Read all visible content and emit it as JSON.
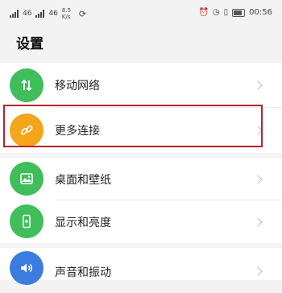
{
  "status_bar": {
    "carrier_1": "46",
    "carrier_2": "46",
    "speed": "8.5 K/s",
    "time": "00:56"
  },
  "page": {
    "title": "设置"
  },
  "settings": {
    "items": [
      {
        "label": "移动网络",
        "icon": "mobile-network-icon",
        "color": "#3fbe5b"
      },
      {
        "label": "更多连接",
        "icon": "link-icon",
        "color": "#f4a51c"
      },
      {
        "label": "桌面和壁纸",
        "icon": "wallpaper-icon",
        "color": "#3fbe5b"
      },
      {
        "label": "显示和亮度",
        "icon": "display-phone-icon",
        "color": "#3fbe5b"
      },
      {
        "label": "声音和振动",
        "icon": "sound-icon",
        "color": "#3a7ce0"
      }
    ]
  },
  "highlight_color": "#b4232a"
}
